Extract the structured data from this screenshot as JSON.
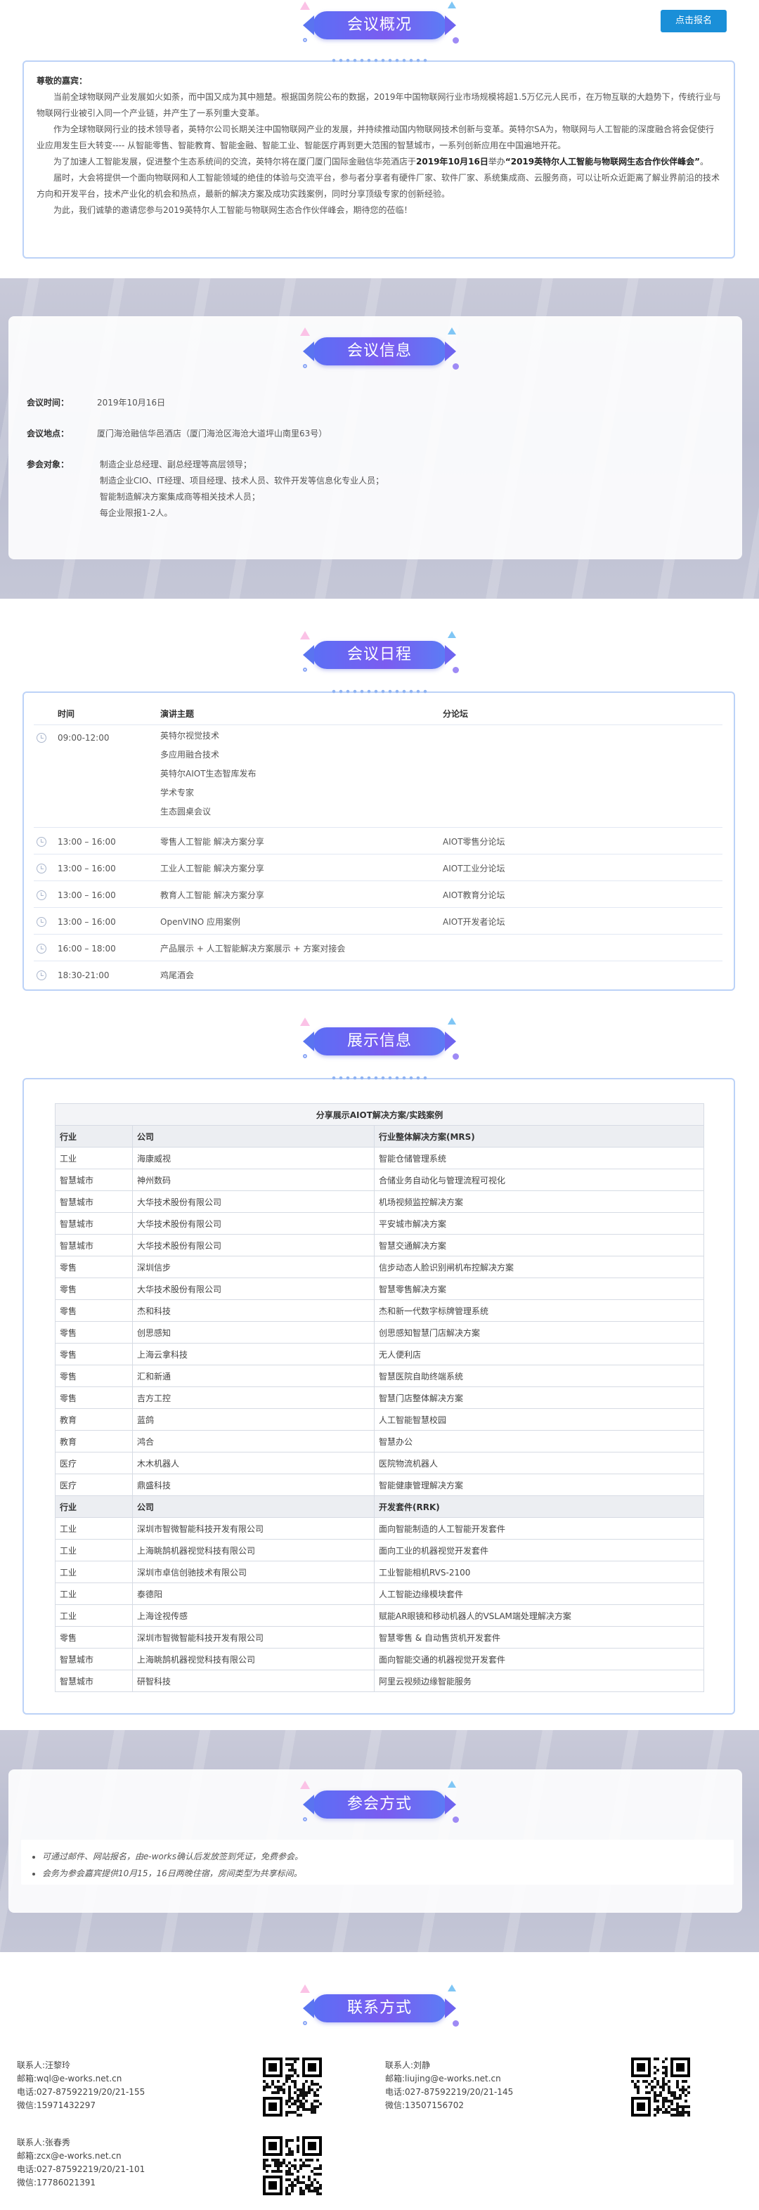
{
  "header": {
    "register_label": "点击报名"
  },
  "sections": {
    "overview": "会议概况",
    "info": "会议信息",
    "schedule": "会议日程",
    "exhibit": "展示信息",
    "join": "参会方式",
    "contact": "联系方式"
  },
  "overview": {
    "greeting": "尊敬的嘉宾：",
    "p1": "当前全球物联网产业发展如火如荼，而中国又成为其中翘楚。根据国务院公布的数据，2019年中国物联网行业市场规模将超1.5万亿元人民币，在万物互联的大趋势下，传统行业与物联网行业被引入同一个产业链，并产生了一系列重大变革。",
    "p2": "作为全球物联网行业的技术领导者，英特尔公司长期关注中国物联网产业的发展，并持续推动国内物联网技术创新与变革。英特尔SA为，物联网与人工智能的深度融合将会促使行业应用发生巨大转变---- 从智能零售、智能教育、智能金融、智能工业、智能医疗再到更大范围的智慧城市，一系列创新应用在中国遍地开花。",
    "p3a": "为了加速人工智能发展，促进整个生态系统间的交流，英特尔将在厦门厦门国际金融信华苑酒店于",
    "p3b": "2019年10月16日",
    "p3c": "举办",
    "p3d": "“2019英特尔人工智能与物联网生态合作伙伴峰会”",
    "p3e": "。",
    "p4": "届时，大会将提供一个面向物联网和人工智能领域的绝佳的体验与交流平台，参与者分享者有硬件厂家、软件厂家、系统集成商、云服务商，可以让听众近距离了解业界前沿的技术方向和开发平台，技术产业化的机会和热点，最新的解决方案及成功实践案例，同时分享顶级专家的创新经验。",
    "p5": "为此，我们诚挚的邀请您参与2019英特尔人工智能与物联网生态合作伙伴峰会，期待您的莅临！"
  },
  "info": {
    "time_label": "会议时间：",
    "time_value": "2019年10月16日",
    "place_label": "会议地点：",
    "place_value": "厦门海沧融信华邑酒店（厦门海沧区海沧大道坪山南里63号）",
    "audience_label": "参会对象：",
    "audience": [
      "制造企业总经理、副总经理等高层领导；",
      "制造企业CIO、IT经理、项目经理、技术人员、软件开发等信息化专业人员；",
      "智能制造解决方案集成商等相关技术人员；",
      "每企业限报1-2人。"
    ]
  },
  "schedule": {
    "headers": [
      "时间",
      "演讲主题",
      "分论坛"
    ],
    "rows": [
      {
        "time": "09:00-12:00",
        "topics": [
          "英特尔视觉技术",
          "多应用融合技术",
          "英特尔AIOT生态智库发布",
          "学术专家",
          "生态圆桌会议"
        ],
        "forum": ""
      },
      {
        "time": "13:00 – 16:00",
        "topics": [
          "零售人工智能 解决方案分享"
        ],
        "forum": "AIOT零售分论坛"
      },
      {
        "time": "13:00 – 16:00",
        "topics": [
          "工业人工智能 解决方案分享"
        ],
        "forum": "AIOT工业分论坛"
      },
      {
        "time": "13:00 – 16:00",
        "topics": [
          "教育人工智能 解决方案分享"
        ],
        "forum": "AIOT教育分论坛"
      },
      {
        "time": "13:00 – 16:00",
        "topics": [
          "OpenVINO 应用案例"
        ],
        "forum": "AIOT开发者论坛"
      },
      {
        "time": "16:00 – 18:00",
        "topics": [
          "产品展示 + 人工智能解决方案展示 + 方案对接会"
        ],
        "forum": ""
      },
      {
        "time": "18:30-21:00",
        "topics": [
          "鸡尾酒会"
        ],
        "forum": ""
      }
    ]
  },
  "exhibit": {
    "title": "分享展示AIOT解决方案/实践案例",
    "header1": [
      "行业",
      "公司",
      "行业整体解决方案(MRS)"
    ],
    "rows1": [
      [
        "工业",
        "海康威视",
        "智能仓储管理系统"
      ],
      [
        "智慧城市",
        "神州数码",
        "合储业务自动化与管理流程可视化"
      ],
      [
        "智慧城市",
        "大华技术股份有限公司",
        "机场视频监控解决方案"
      ],
      [
        "智慧城市",
        "大华技术股份有限公司",
        "平安城市解决方案"
      ],
      [
        "智慧城市",
        "大华技术股份有限公司",
        "智慧交通解决方案"
      ],
      [
        "零售",
        "深圳信步",
        "信步动态人脸识别闸机布控解决方案"
      ],
      [
        "零售",
        "大华技术股份有限公司",
        "智慧零售解决方案"
      ],
      [
        "零售",
        "杰和科技",
        "杰和新一代数字标牌管理系统"
      ],
      [
        "零售",
        "创思感知",
        "创思感知智慧门店解决方案"
      ],
      [
        "零售",
        "上海云拿科技",
        "无人便利店"
      ],
      [
        "零售",
        "汇和新通",
        "智慧医院自助终端系统"
      ],
      [
        "零售",
        "吉方工控",
        "智慧门店整体解决方案"
      ],
      [
        "教育",
        "蓝鸽",
        "人工智能智慧校园"
      ],
      [
        "教育",
        "鸿合",
        "智慧办公"
      ],
      [
        "医疗",
        "木木机器人",
        "医院物流机器人"
      ],
      [
        "医疗",
        "鼎盛科技",
        "智能健康管理解决方案"
      ]
    ],
    "header2": [
      "行业",
      "公司",
      "开发套件(RRK)"
    ],
    "rows2": [
      [
        "工业",
        "深圳市智微智能科技开发有限公司",
        "面向智能制造的人工智能开发套件"
      ],
      [
        "工业",
        "上海眺鹄机器视觉科技有限公司",
        "面向工业的机器视觉开发套件"
      ],
      [
        "工业",
        "深圳市卓信创驰技术有限公司",
        "工业智能相机RVS-2100"
      ],
      [
        "工业",
        "泰德阳",
        "人工智能边缘模块套件"
      ],
      [
        "工业",
        "上海诠视传感",
        "赋能AR眼镜和移动机器人的VSLAM端处理解决方案"
      ],
      [
        "零售",
        "深圳市智微智能科技开发有限公司",
        "智慧零售 & 自动售货机开发套件"
      ],
      [
        "智慧城市",
        "上海眺鹄机器视觉科技有限公司",
        "面向智能交通的机器视觉开发套件"
      ],
      [
        "智慧城市",
        "研智科技",
        "阿里云视频边缘智能服务"
      ]
    ]
  },
  "join": {
    "items": [
      "可通过邮件、网站报名，由e-works确认后发放签到凭证，免费参会。",
      "会务为参会嘉宾提供10月15，16日两晚住宿，房间类型为共享标间。"
    ]
  },
  "contacts": [
    {
      "name": "联系人:汪黎玲",
      "email": "邮箱:wql@e-works.net.cn",
      "phone": "电话:027-87592219/20/21-155",
      "wechat": "微信:15971432297"
    },
    {
      "name": "联系人:刘静",
      "email": "邮箱:liujing@e-works.net.cn",
      "phone": "电话:027-87592219/20/21-145",
      "wechat": "微信:13507156702"
    },
    {
      "name": "联系人:张春秀",
      "email": "邮箱:zcx@e-works.net.cn",
      "phone": "电话:027-87592219/20/21-101",
      "wechat": "微信:17786021391"
    }
  ],
  "icons": {
    "clock": "clock-icon",
    "qr": "qr-code-icon",
    "bullet": "bullet-icon"
  },
  "colors": {
    "accent": "#5b6ff5",
    "button": "#1a8fd8",
    "frame": "#bcd2f7",
    "band": "#c1c3d4"
  }
}
